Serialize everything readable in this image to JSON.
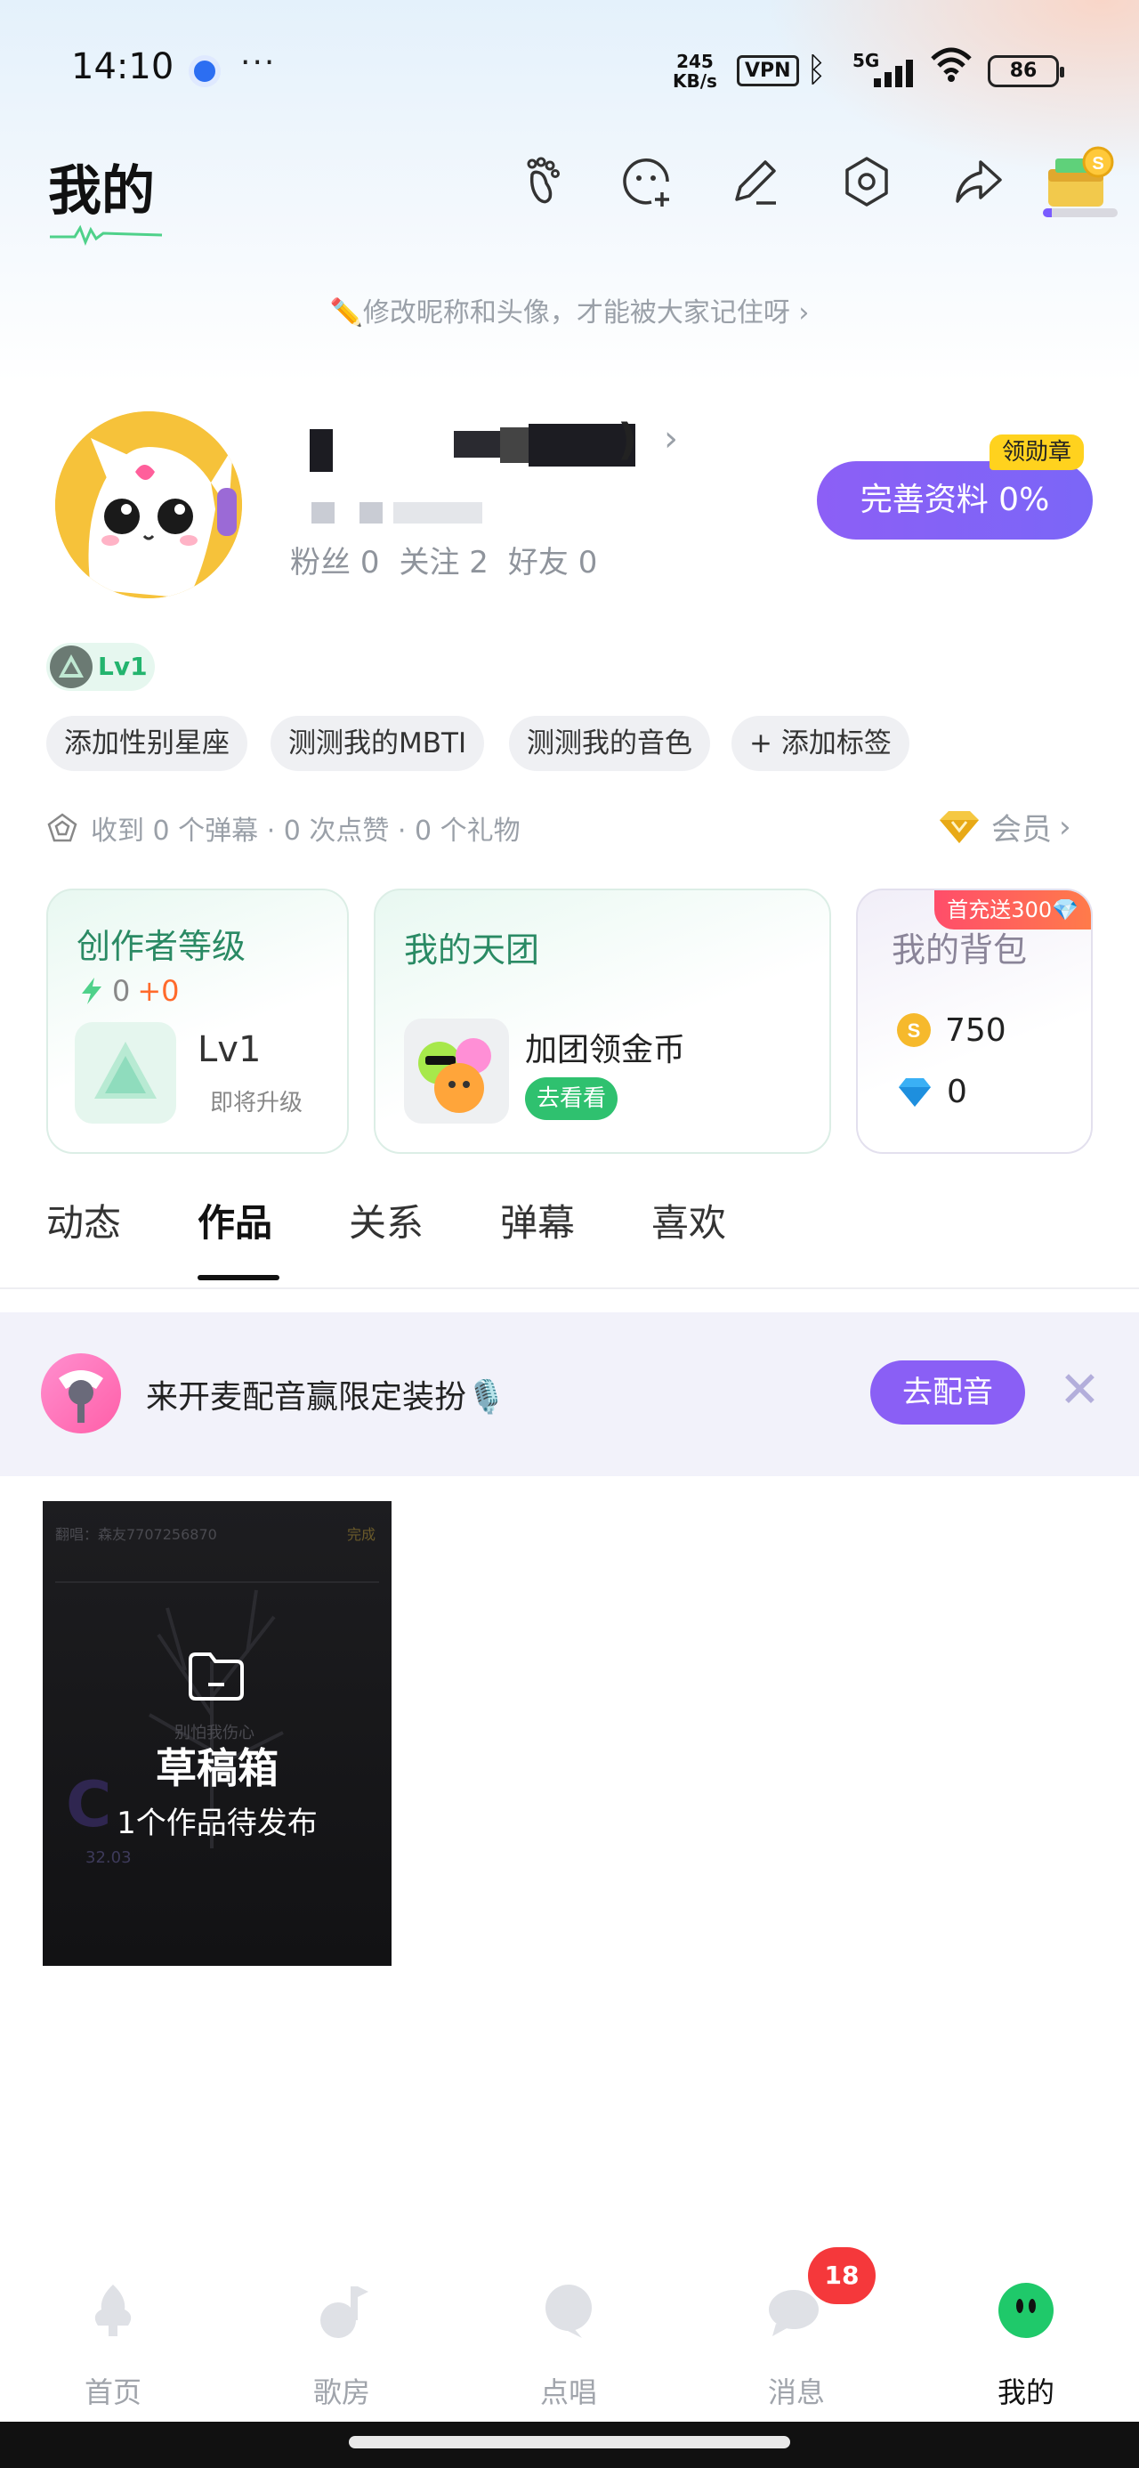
{
  "status_bar": {
    "time": "14:10",
    "dots": "···",
    "speed_top": "245",
    "speed_bottom": "KB/s",
    "vpn": "VPN",
    "network": "5G",
    "battery": "86"
  },
  "header": {
    "title": "我的",
    "icons": [
      "footprint-icon",
      "add-friend-icon",
      "edit-icon",
      "settings-icon",
      "share-icon",
      "coin-reward-icon"
    ]
  },
  "nickname_hint": "✏️修改昵称和头像，才能被大家记住呀 ›",
  "profile": {
    "nickname_visible_fragment": ")",
    "nickname_arrow": "›",
    "stats": {
      "fans_label": "粉丝",
      "fans_value": "0",
      "following_label": "关注",
      "following_value": "2",
      "friends_label": "好友",
      "friends_value": "0"
    },
    "complete_button": "完善资料 0%",
    "medal_badge": "领勋章",
    "level": "Lv1"
  },
  "tags": [
    "添加性别星座",
    "测测我的MBTI",
    "测测我的音色",
    "+ 添加标签"
  ],
  "gifts_summary": "收到 0 个弹幕 · 0 次点赞 · 0 个礼物",
  "vip": {
    "label": "会员",
    "arrow": "›"
  },
  "cards": {
    "creator": {
      "title": "创作者等级",
      "score": "0",
      "delta": "+0",
      "level": "Lv1",
      "status": "即将升级"
    },
    "team": {
      "title": "我的天团",
      "action_text": "加团领金币",
      "button": "去看看"
    },
    "bag": {
      "title": "我的背包",
      "promo": "首充送300💎",
      "coins": "750",
      "diamonds": "0"
    }
  },
  "tabs": [
    {
      "label": "动态",
      "active": false
    },
    {
      "label": "作品",
      "active": true
    },
    {
      "label": "关系",
      "active": false
    },
    {
      "label": "弹幕",
      "active": false
    },
    {
      "label": "喜欢",
      "active": false
    }
  ],
  "banner": {
    "text": "来开麦配音赢限定装扮🎙️",
    "button": "去配音",
    "close": "✕"
  },
  "draft": {
    "title": "草稿箱",
    "subtitle": "1个作品待发布",
    "bg_text_top": "翻唱：森友7707256870",
    "bg_text_done": "完成",
    "bg_text_mid": "别怕我伤心",
    "bg_text_score": "32.03"
  },
  "bottom_nav": [
    {
      "label": "首页",
      "icon": "home-icon",
      "active": false
    },
    {
      "label": "歌房",
      "icon": "music-room-icon",
      "active": false
    },
    {
      "label": "点唱",
      "icon": "request-song-icon",
      "active": false
    },
    {
      "label": "消息",
      "icon": "message-icon",
      "active": false
    },
    {
      "label": "我的",
      "icon": "profile-icon",
      "active": true
    }
  ],
  "message_badge": "18",
  "colors": {
    "accent_purple": "#8a5ff5",
    "accent_green": "#23b46e",
    "badge_red": "#f5383b",
    "medal_yellow": "#ffd21e"
  }
}
